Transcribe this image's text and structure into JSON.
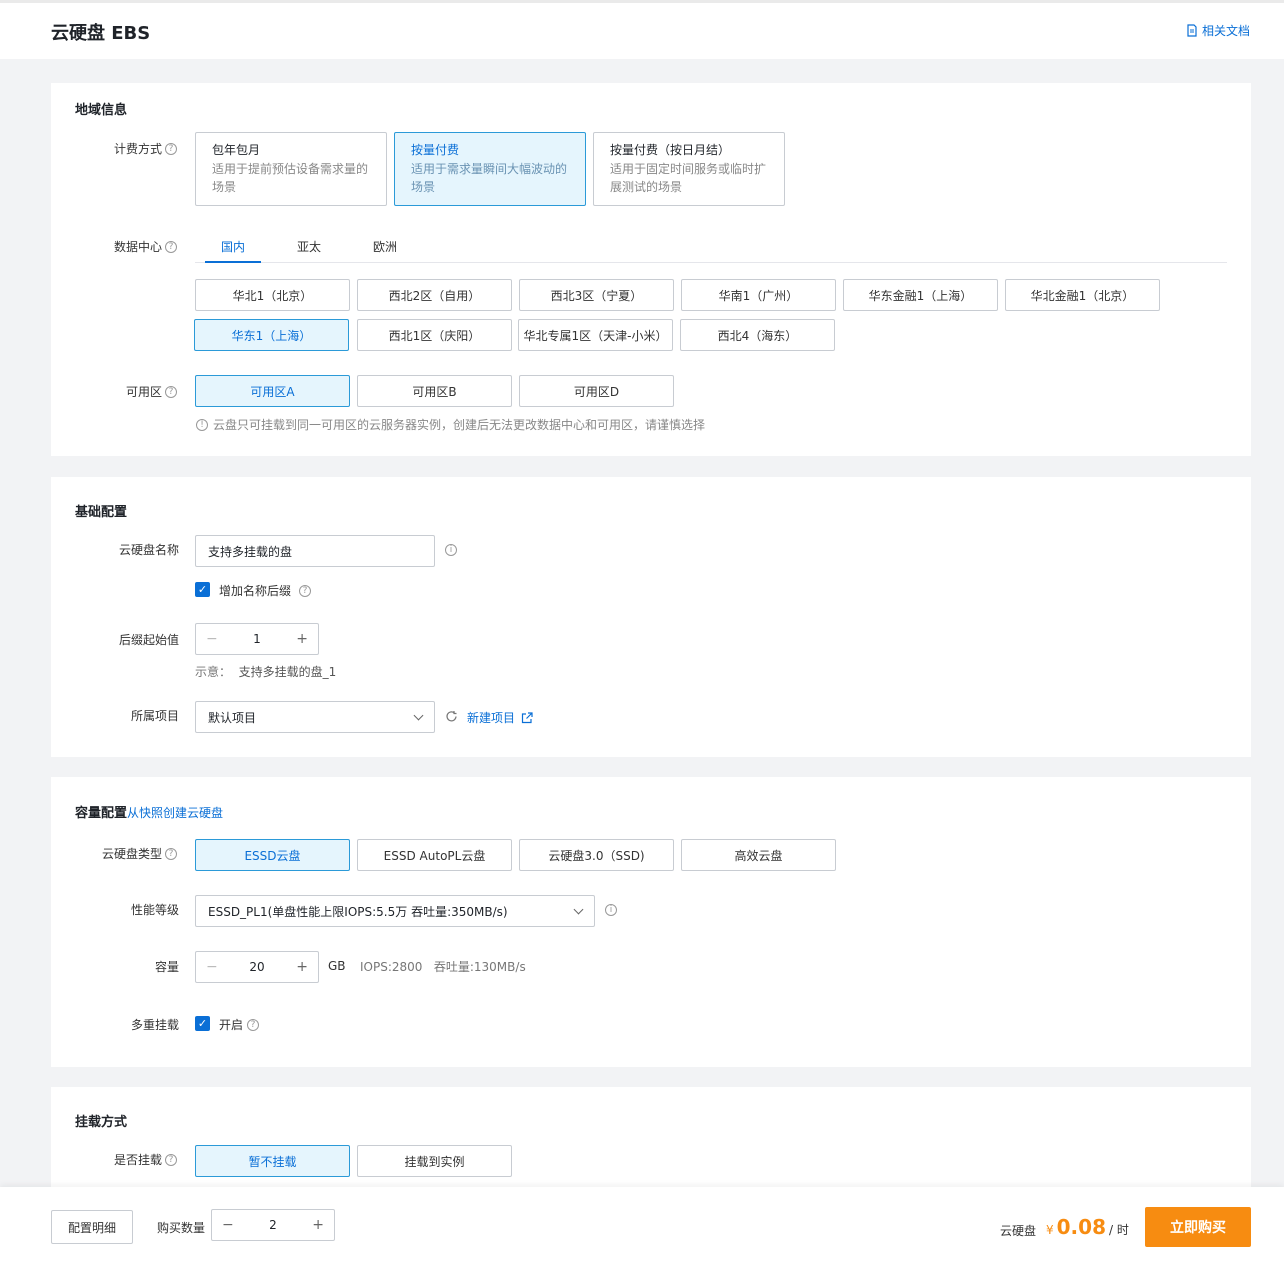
{
  "header": {
    "title": "云硬盘 EBS",
    "doc_link": "相关文档"
  },
  "region": {
    "section_title": "地域信息",
    "billing_label": "计费方式",
    "billing_options": [
      {
        "title": "包年包月",
        "desc": "适用于提前预估设备需求量的场景"
      },
      {
        "title": "按量付费",
        "desc": "适用于需求量瞬间大幅波动的场景"
      },
      {
        "title": "按量付费（按日月结）",
        "desc": "适用于固定时间服务或临时扩展测试的场景"
      }
    ],
    "billing_selected": 1,
    "datacenter_label": "数据中心",
    "tabs": [
      "国内",
      "亚太",
      "欧洲"
    ],
    "tab_active": 0,
    "regions": [
      "华北1（北京）",
      "西北2区（自用）",
      "西北3区（宁夏）",
      "华南1（广州）",
      "华东金融1（上海）",
      "华北金融1（北京）",
      "华东1（上海）",
      "西北1区（庆阳）",
      "华北专属1区（天津-小米）",
      "西北4（海东）"
    ],
    "region_selected": 6,
    "zone_label": "可用区",
    "zones": [
      "可用区A",
      "可用区B",
      "可用区D"
    ],
    "zone_selected": 0,
    "hint": "云盘只可挂载到同一可用区的云服务器实例，创建后无法更改数据中心和可用区，请谨慎选择"
  },
  "basic": {
    "section_title": "基础配置",
    "name_label": "云硬盘名称",
    "name_value": "支持多挂载的盘",
    "suffix_checkbox_label": "增加名称后缀",
    "suffix_checked": true,
    "suffix_start_label": "后缀起始值",
    "suffix_start_value": "1",
    "example_label": "示意：",
    "example_value": "支持多挂载的盘_1",
    "project_label": "所属项目",
    "project_value": "默认项目",
    "new_project_link": "新建项目"
  },
  "capacity": {
    "section_title": "容量配置",
    "snapshot_link": "从快照创建云硬盘",
    "type_label": "云硬盘类型",
    "types": [
      "ESSD云盘",
      "ESSD AutoPL云盘",
      "云硬盘3.0（SSD)",
      "高效云盘"
    ],
    "type_selected": 0,
    "perf_label": "性能等级",
    "perf_value": "ESSD_PL1(单盘性能上限IOPS:5.5万 吞吐量:350MB/s)",
    "size_label": "容量",
    "size_value": "20",
    "size_unit": "GB",
    "size_info": "IOPS:2800   吞吐量:130MB/s",
    "multi_attach_label": "多重挂载",
    "multi_attach_checkbox": "开启",
    "multi_attach_checked": true
  },
  "mount": {
    "section_title": "挂载方式",
    "attach_label": "是否挂载",
    "options": [
      "暂不挂载",
      "挂载到实例"
    ],
    "selected": 0
  },
  "footer": {
    "config_detail": "配置明细",
    "quantity_label": "购买数量",
    "quantity_value": "2",
    "price_label": "云硬盘",
    "currency": "¥",
    "price": "0.08",
    "price_unit": "/ 时",
    "buy_button": "立即购买"
  },
  "colors": {
    "accent": "#0a6fd6",
    "selected_bg": "#e5f5fd",
    "buy": "#f78c11"
  }
}
